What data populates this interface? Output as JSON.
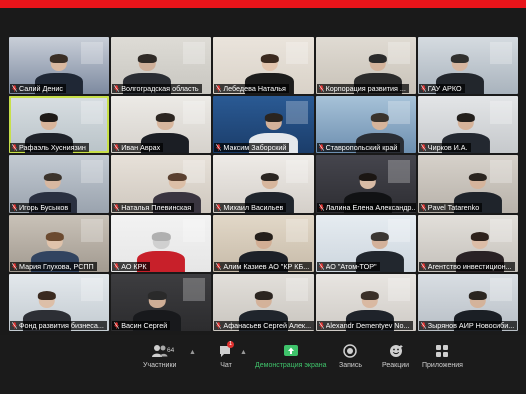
{
  "tiles": [
    {
      "name": "Салий Денис",
      "bg": "#7d8aa0",
      "wall": "#c9cfd8",
      "suit": "#1f2735",
      "skin": "#d9b8a0",
      "hair": "#3a2e25"
    },
    {
      "name": "Волгоградская область",
      "bg": "#c8c6c0",
      "wall": "#dedcd6",
      "suit": "#2a2d33",
      "skin": "#cfb09a",
      "hair": "#2f2a26"
    },
    {
      "name": "Лебедева Наталья",
      "bg": "#d9d2c8",
      "wall": "#eae4dc",
      "suit": "#1c1c1c",
      "skin": "#e2c4ad",
      "hair": "#3b2a1f"
    },
    {
      "name": "Корпорация развития ...",
      "bg": "#c8c2b8",
      "wall": "#e0dbd3",
      "suit": "#2b2b2b",
      "skin": "#d4b49c",
      "hair": "#2a2a2a"
    },
    {
      "name": "ГАУ АРКО",
      "bg": "#a9b3bd",
      "wall": "#d5dbe0",
      "suit": "#22262c",
      "skin": "#d6b6a0",
      "hair": "#30302e"
    },
    {
      "name": "Рафаэль Хусниязин",
      "bg": "#b9c3c8",
      "wall": "#d8dee2",
      "suit": "#1e2229",
      "skin": "#d8b59b",
      "hair": "#1e1a17",
      "active": true
    },
    {
      "name": "Иван Аврах",
      "bg": "#d6d2cc",
      "wall": "#eceae6",
      "suit": "#1b1e24",
      "skin": "#d8b79e",
      "hair": "#2c2621"
    },
    {
      "name": "Максим Заборский",
      "bg": "#1b3d6a",
      "wall": "#2a5a94",
      "suit": "#e5e8ec",
      "skin": "#d4b29a",
      "hair": "#2a241f"
    },
    {
      "name": "Ставропольский край",
      "bg": "#6d8fb0",
      "wall": "#a7c2d8",
      "suit": "#2a2e35",
      "skin": "#d6b49b",
      "hair": "#3a332c"
    },
    {
      "name": "Чирков И.А.",
      "bg": "#c6c9cc",
      "wall": "#e3e5e7",
      "suit": "#232830",
      "skin": "#d6b39a",
      "hair": "#231f1c"
    },
    {
      "name": "Игорь Бусыков",
      "bg": "#9aa3ae",
      "wall": "#c3cad2",
      "suit": "#2a3040",
      "skin": "#d8b8a1",
      "hair": "#3c342c"
    },
    {
      "name": "Наталья Плевинская",
      "bg": "#cfc8bf",
      "wall": "#e7e1d9",
      "suit": "#3a3540",
      "skin": "#dcbfa8",
      "hair": "#5a4030"
    },
    {
      "name": "Михаил Васильев",
      "bg": "#d4cfc9",
      "wall": "#eeebe7",
      "suit": "#20252c",
      "skin": "#d7b69d",
      "hair": "#2b2622"
    },
    {
      "name": "Лалина Елена Александр...",
      "bg": "#2e2e33",
      "wall": "#45454d",
      "suit": "#111214",
      "skin": "#d8bba5",
      "hair": "#1b1613"
    },
    {
      "name": "Pavel Tatarenko",
      "bg": "#b8b2aa",
      "wall": "#d6d1ca",
      "suit": "#1f242b",
      "skin": "#d5b49c",
      "hair": "#2a241f"
    },
    {
      "name": "Мария Глухова, РСПП",
      "bg": "#a29a90",
      "wall": "#c9c2b8",
      "suit": "#324460",
      "skin": "#e0c3ab",
      "hair": "#6b4a30"
    },
    {
      "name": "АО КРК",
      "bg": "#e6e6e6",
      "wall": "#f2f2f2",
      "suit": "#c8202a",
      "skin": "#d0d0d0",
      "hair": "#b0b0b0"
    },
    {
      "name": "Алим Казиев АО \"КР КБ...",
      "bg": "#c7bba9",
      "wall": "#e2d8c8",
      "suit": "#1d2128",
      "skin": "#d2ae94",
      "hair": "#241f1b"
    },
    {
      "name": "АО \"Атом-ТОР\"",
      "bg": "#cdd6de",
      "wall": "#e6ecf1",
      "suit": "#22272e",
      "skin": "#d3b19a",
      "hair": "#3a3632"
    },
    {
      "name": "Агентство инвестицион...",
      "bg": "#c5c1bb",
      "wall": "#e2dfda",
      "suit": "#2a2225",
      "skin": "#dcbda7",
      "hair": "#2e221c"
    },
    {
      "name": "Фонд развития бизнеса...",
      "bg": "#c3cbd1",
      "wall": "#e3e8ec",
      "suit": "#2d2f35",
      "skin": "#ddbfa8",
      "hair": "#3a2a20"
    },
    {
      "name": "Васин Сергей",
      "bg": "#2c2c2e",
      "wall": "#3d3d40",
      "suit": "#18191c",
      "skin": "#cfae96",
      "hair": "#2a2a2a"
    },
    {
      "name": "Афанасьев Сергей Алек...",
      "bg": "#c9c5bf",
      "wall": "#e2dfda",
      "suit": "#20252c",
      "skin": "#d4b29a",
      "hair": "#2b2520"
    },
    {
      "name": "Alexandr Dementyev No...",
      "bg": "#cfcbc6",
      "wall": "#e8e5e1",
      "suit": "#1f232a",
      "skin": "#d9b9a2",
      "hair": "#3a3028"
    },
    {
      "name": "Зырянов АИР Новосиби...",
      "bg": "#b8bfc6",
      "wall": "#d9dee3",
      "suit": "#1b1f25",
      "skin": "#d4b39b",
      "hair": "#2a2520"
    }
  ],
  "toolbar": {
    "participants_label": "Участники",
    "participants_count": "64",
    "chat_label": "Чат",
    "chat_badge": "1",
    "share_label": "Демонстрация экрана",
    "record_label": "Запись",
    "reactions_label": "Реакции",
    "apps_label": "Приложения"
  },
  "colors": {
    "top_accent": "#e8141a",
    "share_green": "#3fc36b",
    "mic_muted": "#e0312f"
  }
}
